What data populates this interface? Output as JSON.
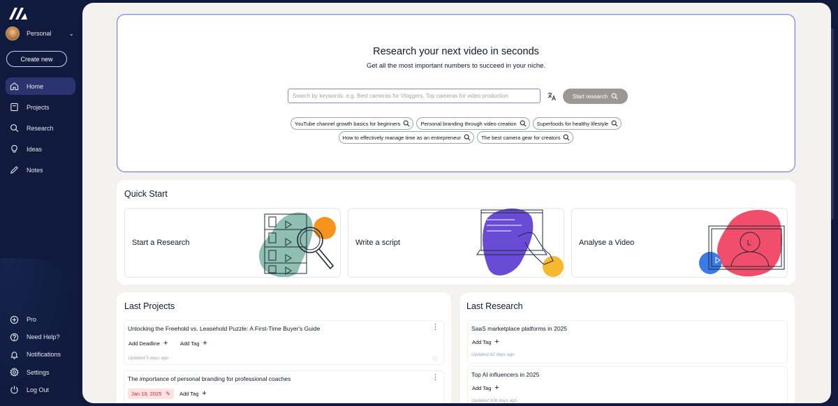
{
  "sidebar": {
    "profile_name": "Personal",
    "create_label": "Create new",
    "nav": [
      {
        "label": "Home",
        "icon": "home-icon",
        "active": true
      },
      {
        "label": "Projects",
        "icon": "projects-icon"
      },
      {
        "label": "Research",
        "icon": "search-icon"
      },
      {
        "label": "Ideas",
        "icon": "lightbulb-icon"
      },
      {
        "label": "Notes",
        "icon": "pencil-icon"
      }
    ],
    "bottom": [
      {
        "label": "Pro",
        "icon": "plus-circle-icon"
      },
      {
        "label": "Need Help?",
        "icon": "help-icon"
      },
      {
        "label": "Notifications",
        "icon": "bell-icon"
      },
      {
        "label": "Settings",
        "icon": "gear-icon"
      },
      {
        "label": "Log Out",
        "icon": "power-icon"
      }
    ]
  },
  "hero": {
    "title": "Research your next video in seconds",
    "subtitle": "Get all the most important numbers to succeed in your niche.",
    "search_placeholder": "Search by keywords: e.g. Best cameras for Vloggers, Top cameras for video production",
    "search_value": "",
    "start_label": "Start research",
    "chips_row1": [
      "YouTube channel growth basics for beginners",
      "Personal branding through video creation",
      "Superfoods for healthy lifestyle"
    ],
    "chips_row2": [
      "How to effectively manage time as an entrepreneur",
      "The best camera gear for creators"
    ]
  },
  "quick_start": {
    "title": "Quick Start",
    "cards": [
      "Start a Research",
      "Write a script",
      "Analyse a Video"
    ]
  },
  "last_projects": {
    "title": "Last Projects",
    "items": [
      {
        "title": "Unlocking the Freehold vs. Leasehold Puzzle: A First-Time Buyer's Guide",
        "deadline_label": "Add Deadline",
        "tag_label": "Add Tag",
        "updated": "Updated 5 days ago"
      },
      {
        "title": "The importance of personal branding for professional coaches",
        "date": "Jan 19, 2025",
        "tag_label": "Add Tag"
      }
    ]
  },
  "last_research": {
    "title": "Last Research",
    "items": [
      {
        "title": "SaaS marketplace platforms in 2025",
        "tag_label": "Add Tag",
        "updated": "Updated 62 days ago"
      },
      {
        "title": "Top AI influencers in 2025",
        "tag_label": "Add Tag",
        "updated": "Updated 106 days ago"
      }
    ]
  },
  "colors": {
    "sidebar": "#0f1a3d",
    "accent": "#8b7cf0",
    "teal": "#8fbfb1",
    "orange": "#f7941d",
    "purple": "#6a4bd6",
    "yellow": "#f5b82e",
    "pink": "#f04e6a",
    "blue": "#3b7be8"
  }
}
